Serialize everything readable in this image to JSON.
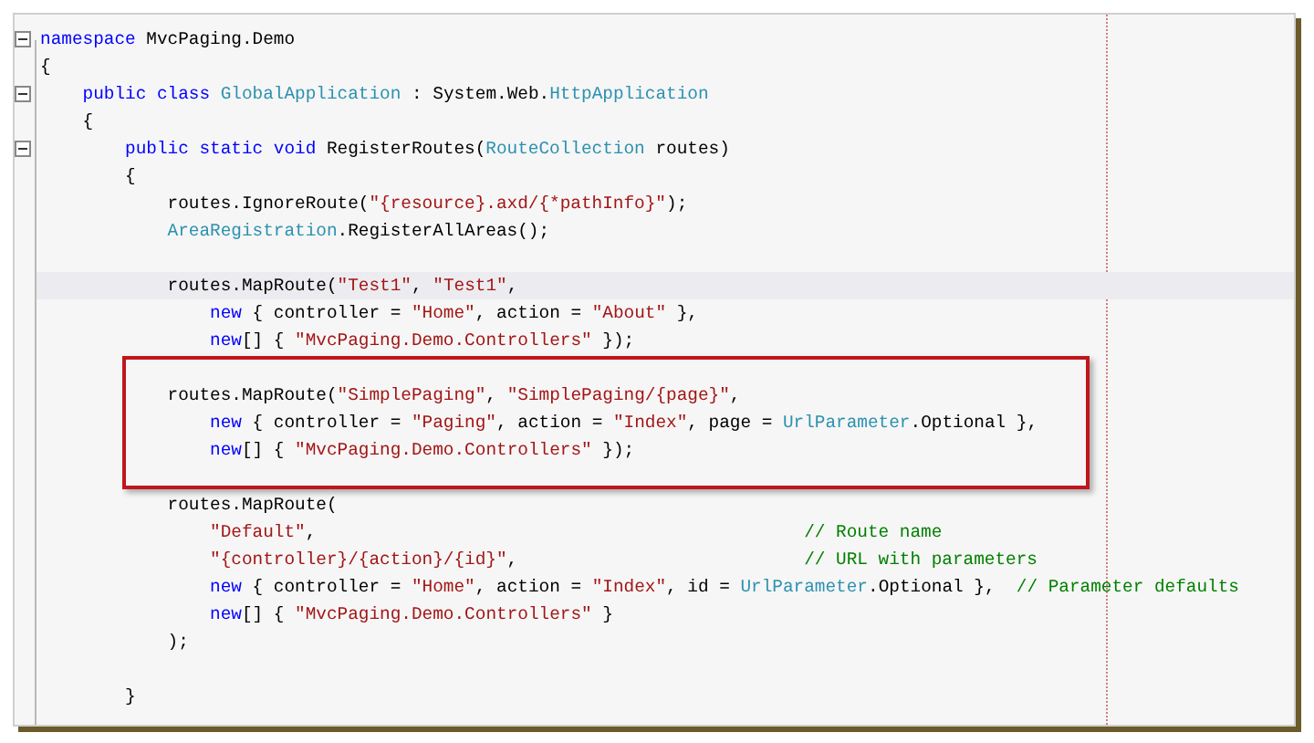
{
  "editor": {
    "lines": [
      {
        "fold": {
          "expanded": true
        },
        "current": false,
        "boxed": false,
        "tokens": [
          {
            "kind": "kw",
            "text": "namespace"
          },
          {
            "kind": "txt",
            "text": " MvcPaging.Demo"
          }
        ]
      },
      {
        "current": false,
        "boxed": false,
        "tokens": [
          {
            "kind": "txt",
            "text": "{"
          }
        ]
      },
      {
        "fold": {
          "expanded": true
        },
        "current": false,
        "boxed": false,
        "tokens": [
          {
            "kind": "kw",
            "text": "    public class "
          },
          {
            "kind": "type",
            "text": "GlobalApplication"
          },
          {
            "kind": "txt",
            "text": " : System.Web."
          },
          {
            "kind": "type",
            "text": "HttpApplication"
          }
        ]
      },
      {
        "current": false,
        "boxed": false,
        "tokens": [
          {
            "kind": "txt",
            "text": "    {"
          }
        ]
      },
      {
        "fold": {
          "expanded": true
        },
        "current": false,
        "boxed": false,
        "tokens": [
          {
            "kind": "kw",
            "text": "        public static void"
          },
          {
            "kind": "txt",
            "text": " RegisterRoutes("
          },
          {
            "kind": "type",
            "text": "RouteCollection"
          },
          {
            "kind": "txt",
            "text": " routes)"
          }
        ]
      },
      {
        "current": false,
        "boxed": false,
        "tokens": [
          {
            "kind": "txt",
            "text": "        {"
          }
        ]
      },
      {
        "current": false,
        "boxed": false,
        "tokens": [
          {
            "kind": "txt",
            "text": "            routes.IgnoreRoute("
          },
          {
            "kind": "str",
            "text": "\"{resource}.axd/{*pathInfo}\""
          },
          {
            "kind": "txt",
            "text": ");"
          }
        ]
      },
      {
        "current": false,
        "boxed": false,
        "tokens": [
          {
            "kind": "type",
            "text": "            AreaRegistration"
          },
          {
            "kind": "txt",
            "text": ".RegisterAllAreas();"
          }
        ]
      },
      {
        "current": false,
        "boxed": false
      },
      {
        "current": true,
        "boxed": false,
        "tokens": [
          {
            "kind": "txt",
            "text": "            routes.MapRoute("
          },
          {
            "kind": "str",
            "text": "\"Test1\""
          },
          {
            "kind": "txt",
            "text": ", "
          },
          {
            "kind": "str",
            "text": "\"Test1\""
          },
          {
            "kind": "txt",
            "text": ","
          }
        ]
      },
      {
        "current": false,
        "boxed": false,
        "tokens": [
          {
            "kind": "kw",
            "text": "                new"
          },
          {
            "kind": "txt",
            "text": " { controller = "
          },
          {
            "kind": "str",
            "text": "\"Home\""
          },
          {
            "kind": "txt",
            "text": ", action = "
          },
          {
            "kind": "str",
            "text": "\"About\""
          },
          {
            "kind": "txt",
            "text": " },"
          }
        ]
      },
      {
        "current": false,
        "boxed": false,
        "tokens": [
          {
            "kind": "kw",
            "text": "                new"
          },
          {
            "kind": "txt",
            "text": "[] { "
          },
          {
            "kind": "str",
            "text": "\"MvcPaging.Demo.Controllers\""
          },
          {
            "kind": "txt",
            "text": " });"
          }
        ]
      },
      {
        "current": false,
        "boxed": true
      },
      {
        "current": false,
        "boxed": true,
        "tokens": [
          {
            "kind": "txt",
            "text": "            routes.MapRoute("
          },
          {
            "kind": "str",
            "text": "\"SimplePaging\""
          },
          {
            "kind": "txt",
            "text": ", "
          },
          {
            "kind": "str",
            "text": "\"SimplePaging/{page}\""
          },
          {
            "kind": "txt",
            "text": ","
          }
        ]
      },
      {
        "current": false,
        "boxed": true,
        "tokens": [
          {
            "kind": "kw",
            "text": "                new"
          },
          {
            "kind": "txt",
            "text": " { controller = "
          },
          {
            "kind": "str",
            "text": "\"Paging\""
          },
          {
            "kind": "txt",
            "text": ", action = "
          },
          {
            "kind": "str",
            "text": "\"Index\""
          },
          {
            "kind": "txt",
            "text": ", page = "
          },
          {
            "kind": "type",
            "text": "UrlParameter"
          },
          {
            "kind": "txt",
            "text": ".Optional },"
          }
        ]
      },
      {
        "current": false,
        "boxed": true,
        "tokens": [
          {
            "kind": "kw",
            "text": "                new"
          },
          {
            "kind": "txt",
            "text": "[] { "
          },
          {
            "kind": "str",
            "text": "\"MvcPaging.Demo.Controllers\""
          },
          {
            "kind": "txt",
            "text": " });"
          }
        ]
      },
      {
        "current": false,
        "boxed": true
      },
      {
        "current": false,
        "boxed": false,
        "tokens": [
          {
            "kind": "txt",
            "text": "            routes.MapRoute("
          }
        ]
      },
      {
        "current": false,
        "boxed": false,
        "tokens": [
          {
            "kind": "str",
            "text": "                \"Default\""
          },
          {
            "kind": "txt",
            "text": ",                                              "
          },
          {
            "kind": "cmt",
            "text": "// Route name"
          }
        ]
      },
      {
        "current": false,
        "boxed": false,
        "tokens": [
          {
            "kind": "str",
            "text": "                \"{controller}/{action}/{id}\""
          },
          {
            "kind": "txt",
            "text": ",                           "
          },
          {
            "kind": "cmt",
            "text": "// URL with parameters"
          }
        ]
      },
      {
        "current": false,
        "boxed": false,
        "tokens": [
          {
            "kind": "kw",
            "text": "                new"
          },
          {
            "kind": "txt",
            "text": " { controller = "
          },
          {
            "kind": "str",
            "text": "\"Home\""
          },
          {
            "kind": "txt",
            "text": ", action = "
          },
          {
            "kind": "str",
            "text": "\"Index\""
          },
          {
            "kind": "txt",
            "text": ", id = "
          },
          {
            "kind": "type",
            "text": "UrlParameter"
          },
          {
            "kind": "txt",
            "text": ".Optional },  "
          },
          {
            "kind": "cmt",
            "text": "// Parameter defaults"
          }
        ]
      },
      {
        "current": false,
        "boxed": false,
        "tokens": [
          {
            "kind": "kw",
            "text": "                new"
          },
          {
            "kind": "txt",
            "text": "[] { "
          },
          {
            "kind": "str",
            "text": "\"MvcPaging.Demo.Controllers\""
          },
          {
            "kind": "txt",
            "text": " }"
          }
        ]
      },
      {
        "current": false,
        "boxed": false,
        "tokens": [
          {
            "kind": "txt",
            "text": "            );"
          }
        ]
      },
      {
        "current": false,
        "boxed": false
      },
      {
        "current": false,
        "boxed": false,
        "tokens": [
          {
            "kind": "txt",
            "text": "        }"
          }
        ]
      }
    ]
  }
}
